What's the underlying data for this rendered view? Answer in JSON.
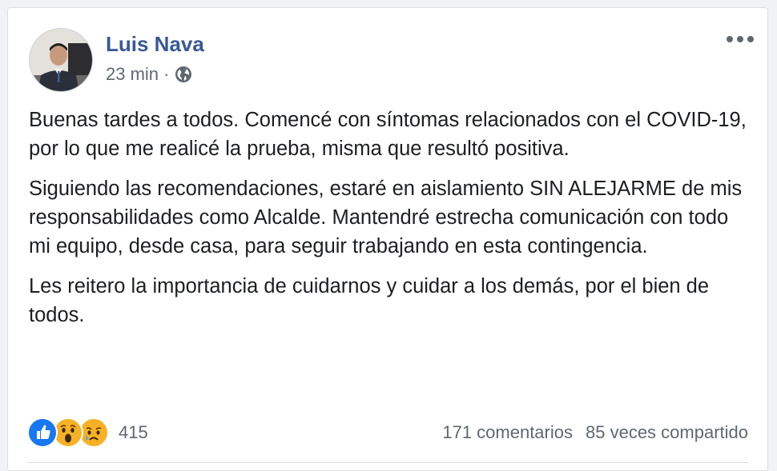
{
  "post": {
    "author": "Luis Nava",
    "time": "23 min",
    "separator": "·",
    "privacy_icon": "globe-icon",
    "paragraphs": [
      "Buenas tardes a todos. Comencé con síntomas relacionados con el COVID-19, por lo que me realicé la prueba, misma que resultó positiva.",
      "Siguiendo las recomendaciones, estaré en aislamiento SIN ALEJARME de mis responsabilidades como Alcalde. Mantendré estrecha comunicación con todo mi equipo, desde casa, para seguir trabajando en esta contingencia.",
      "Les reitero la importancia de cuidarnos y cuidar a los demás, por el bien de todos."
    ]
  },
  "footer": {
    "reactions": [
      "like-icon",
      "wow-icon",
      "sad-icon"
    ],
    "reaction_count": "415",
    "comments": "171 comentarios",
    "shares": "85 veces compartido"
  },
  "colors": {
    "author": "#385898",
    "like": "#1877f2",
    "emoji": "#f7b125"
  }
}
